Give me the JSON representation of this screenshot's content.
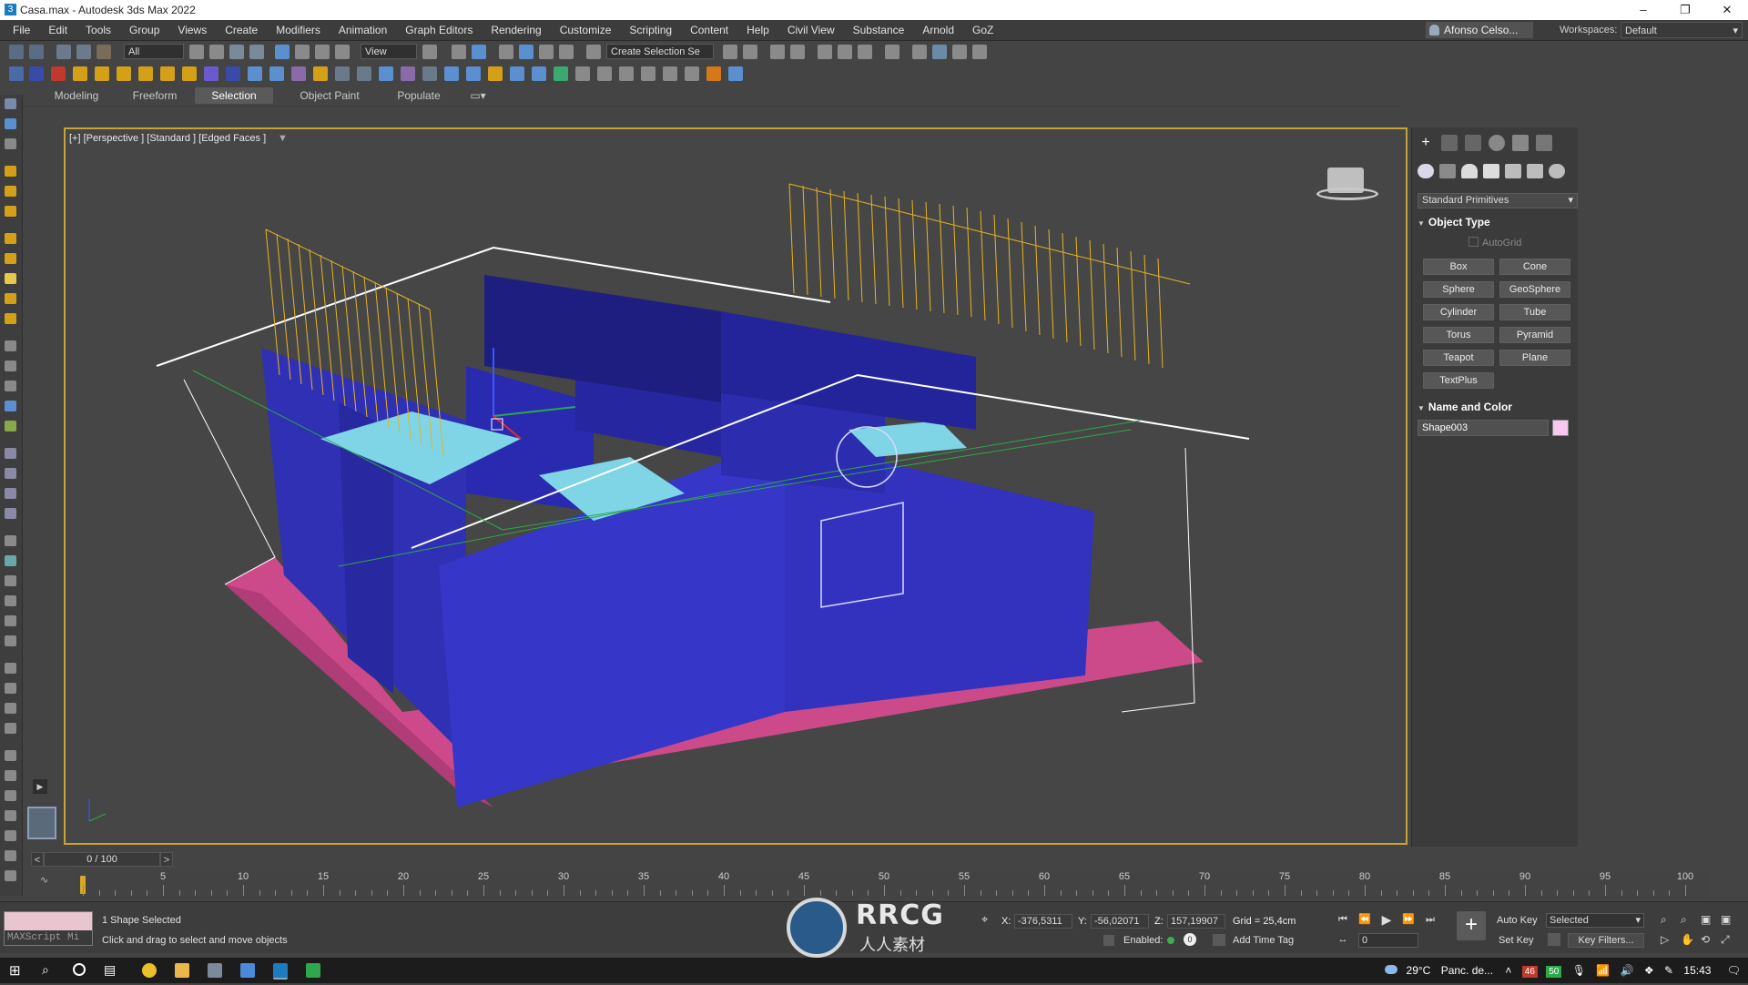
{
  "window": {
    "title": "Casa.max - Autodesk 3ds Max 2022",
    "minimize": "–",
    "maximize": "❐",
    "close": "✕"
  },
  "menu": [
    "File",
    "Edit",
    "Tools",
    "Group",
    "Views",
    "Create",
    "Modifiers",
    "Animation",
    "Graph Editors",
    "Rendering",
    "Customize",
    "Scripting",
    "Content",
    "Help",
    "Civil View",
    "Substance",
    "Arnold",
    "GoZ"
  ],
  "user": {
    "name": "Afonso Celso...",
    "workspaces_label": "Workspaces:",
    "workspace": "Default"
  },
  "toolbar": {
    "filter_select": "All",
    "view_select": "View",
    "selection_set": "Create Selection Se"
  },
  "ribbon_tabs": [
    "Modeling",
    "Freeform",
    "Selection",
    "Object Paint",
    "Populate"
  ],
  "ribbon_active": "Selection",
  "viewport": {
    "label": "[+] [Perspective ] [Standard ] [Edged Faces ]"
  },
  "command_panel": {
    "category": "Standard Primitives",
    "object_type_title": "Object Type",
    "autogrid": "AutoGrid",
    "buttons": [
      "Box",
      "Cone",
      "Sphere",
      "GeoSphere",
      "Cylinder",
      "Tube",
      "Torus",
      "Pyramid",
      "Teapot",
      "Plane",
      "TextPlus"
    ],
    "name_color_title": "Name and Color",
    "object_name": "Shape003",
    "object_color": "#f7c8f0"
  },
  "timeline": {
    "frame_counter": "0 / 100",
    "ticks": [
      "5",
      "10",
      "15",
      "20",
      "25",
      "30",
      "35",
      "40",
      "45",
      "50",
      "55",
      "60",
      "65",
      "70",
      "75",
      "80",
      "85",
      "90",
      "95",
      "100"
    ]
  },
  "status": {
    "maxscript": "MAXScript Mi",
    "selection": "1 Shape Selected",
    "prompt": "Click and drag to select and move objects",
    "x_label": "X:",
    "x": "-376,5311",
    "y_label": "Y:",
    "y": "-56,02071",
    "z_label": "Z:",
    "z": "157,19907",
    "grid": "Grid = 25,4cm",
    "enabled": "Enabled:",
    "add_time_tag": "Add Time Tag",
    "auto_key": "Auto Key",
    "set_key": "Set Key",
    "selected": "Selected",
    "key_filters": "Key Filters...",
    "frame": "0"
  },
  "watermark": {
    "line1": "RRCG",
    "line2": "人人素材"
  },
  "taskbar": {
    "weather": "29°C",
    "location": "Panc. de...",
    "time": "15:43",
    "badge1": "46",
    "badge2": "50"
  }
}
